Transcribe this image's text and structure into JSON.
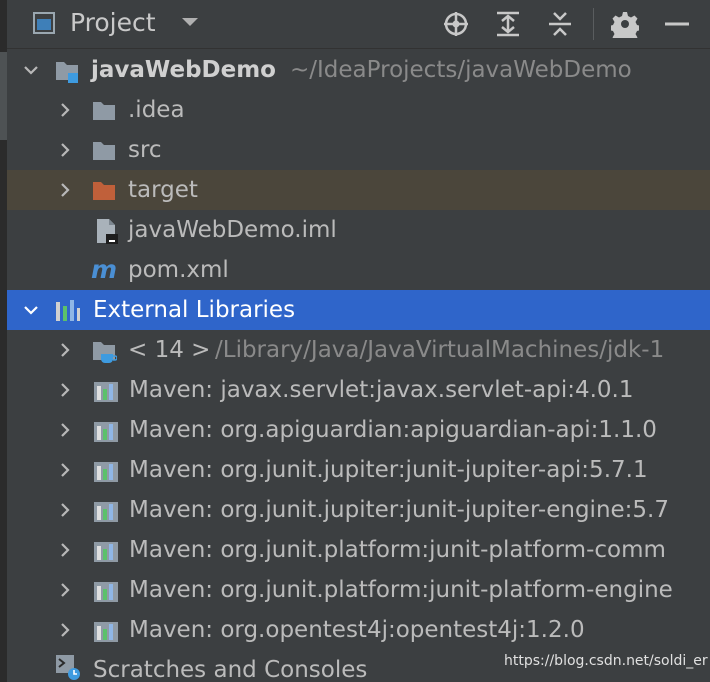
{
  "header": {
    "title": "Project"
  },
  "tree": {
    "root_name": "javaWebDemo",
    "root_path": "~/IdeaProjects/javaWebDemo",
    "folders": {
      "idea": ".idea",
      "src": "src",
      "target": "target"
    },
    "files": {
      "iml": "javaWebDemo.iml",
      "pom": "pom.xml"
    },
    "external_libraries": "External Libraries",
    "jdk": {
      "version": "< 14 >",
      "path": "/Library/Java/JavaVirtualMachines/jdk-1"
    },
    "maven": [
      "Maven: javax.servlet:javax.servlet-api:4.0.1",
      "Maven: org.apiguardian:apiguardian-api:1.1.0",
      "Maven: org.junit.jupiter:junit-jupiter-api:5.7.1",
      "Maven: org.junit.jupiter:junit-jupiter-engine:5.7",
      "Maven: org.junit.platform:junit-platform-comm",
      "Maven: org.junit.platform:junit-platform-engine",
      "Maven: org.opentest4j:opentest4j:1.2.0"
    ],
    "scratches": "Scratches and Consoles"
  },
  "watermark": "https://blog.csdn.net/soldi_er",
  "colors": {
    "selection": "#2f65ca",
    "target_highlight": "#4b463b",
    "folder_target": "#c0603a",
    "folder": "#8f9aa5"
  }
}
